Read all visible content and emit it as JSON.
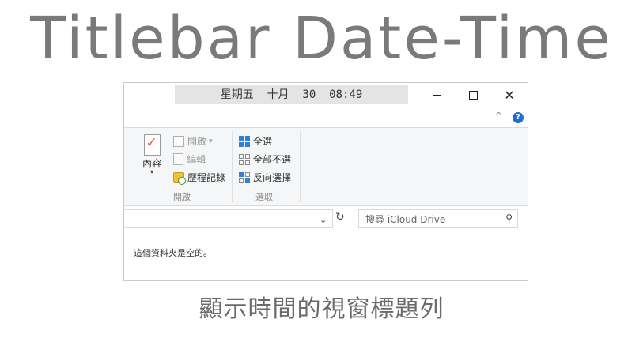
{
  "headline": "Titlebar Date-Time",
  "caption": "顯示時間的視窗標題列",
  "window": {
    "title_datetime": "星期五  十月  30  08:49",
    "controls": {
      "minimize": "—",
      "maximize": "☐",
      "close": "✕"
    },
    "ribbon": {
      "help_icon_text": "?",
      "collapse_icon_text": "^",
      "content_button": {
        "label": "內容",
        "arrow": "▾"
      },
      "open_group": {
        "label": "開啟",
        "items": [
          {
            "label": "開啟",
            "arrow": "▾",
            "icon": "open-icon",
            "enabled": false
          },
          {
            "label": "編輯",
            "icon": "edit-icon",
            "enabled": false
          },
          {
            "label": "歷程記錄",
            "icon": "history-icon",
            "enabled": true
          }
        ]
      },
      "select_group": {
        "label": "選取",
        "items": [
          {
            "label": "全選",
            "icon": "select-all-icon"
          },
          {
            "label": "全部不選",
            "icon": "select-none-icon"
          },
          {
            "label": "反向選擇",
            "icon": "invert-selection-icon"
          }
        ]
      }
    },
    "address_bar": {
      "chevron": "⌄",
      "refresh": "↻"
    },
    "search": {
      "placeholder": "搜尋 iCloud Drive",
      "icon": "⚲"
    },
    "empty_message": "這個資料夾是空的。"
  }
}
